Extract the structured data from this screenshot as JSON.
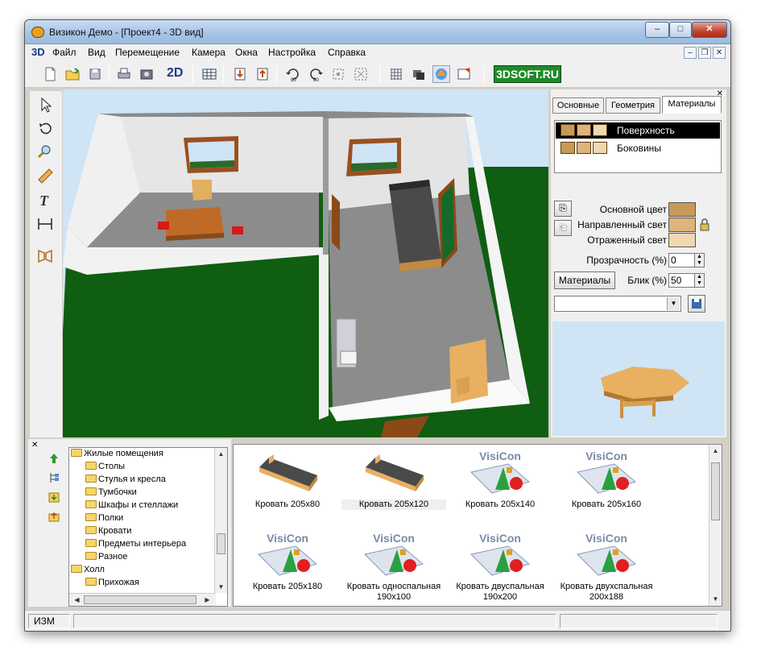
{
  "window": {
    "title": "Визикон Демо - [Проект4 - 3D вид]",
    "controls": {
      "minimize": "‒",
      "maximize": "□",
      "close": "✕"
    }
  },
  "menubar": {
    "logo": "3D",
    "items": [
      "Файл",
      "Вид",
      "Перемещение",
      "Камера",
      "Окна",
      "Настройка",
      "Справка"
    ],
    "mdi": {
      "minimize": "–",
      "restore": "❐",
      "close": "✕"
    }
  },
  "toolbar": {
    "label_2d": "2D",
    "brand": "3DSOFT.RU",
    "icons": [
      "new-file-icon",
      "open-folder-icon",
      "save-icon",
      "print-icon",
      "print-preview-icon",
      "2d-view",
      "table-icon",
      "import-icon",
      "export-icon",
      "rotate-left-90-icon",
      "rotate-right-90-icon",
      "select-group-icon",
      "ungroup-icon",
      "grid-icon",
      "layers-icon",
      "materials-icon",
      "properties-icon"
    ]
  },
  "left_tools": [
    "pointer-icon",
    "rotate-icon",
    "zoom-icon",
    "ruler-icon",
    "text-icon",
    "dimension-icon",
    "door-icon"
  ],
  "right_panel": {
    "tabs": [
      "Основные",
      "Геометрия",
      "Материалы"
    ],
    "active_tab": "Материалы",
    "materials": [
      {
        "label": "Поверхность",
        "selected": true
      },
      {
        "label": "Боковины",
        "selected": false
      }
    ],
    "properties": {
      "main_color_label": "Основной цвет",
      "directed_light_label": "Направленный свет",
      "reflected_light_label": "Отраженный свет",
      "transparency_label": "Прозрачность (%)",
      "transparency_value": "0",
      "gloss_label": "Блик (%)",
      "gloss_value": "50",
      "materials_button": "Материалы",
      "combo_value": ""
    },
    "colors": {
      "main": "#c89a58",
      "directed": "#dcb47c",
      "reflected": "#f0d8b0"
    }
  },
  "tree": {
    "items": [
      {
        "label": "Жилые помещения",
        "level": 0
      },
      {
        "label": "Столы",
        "level": 1
      },
      {
        "label": "Стулья и кресла",
        "level": 1
      },
      {
        "label": "Тумбочки",
        "level": 1
      },
      {
        "label": "Шкафы и стеллажи",
        "level": 1
      },
      {
        "label": "Полки",
        "level": 1
      },
      {
        "label": "Кровати",
        "level": 1
      },
      {
        "label": "Предметы интерьера",
        "level": 1
      },
      {
        "label": "Разное",
        "level": 1
      },
      {
        "label": "Холл",
        "level": 0
      },
      {
        "label": "Прихожая",
        "level": 1
      }
    ],
    "side_icons": [
      "arrow-up-icon",
      "tree-structure-icon",
      "save-library-icon",
      "open-library-icon"
    ]
  },
  "gallery": {
    "placeholder_brand": "VisiCon",
    "items": [
      {
        "caption": "Кровать 205x80",
        "thumb": "bed"
      },
      {
        "caption": "Кровать 205x120",
        "thumb": "bed",
        "selected": true
      },
      {
        "caption": "Кровать 205x140",
        "thumb": "visicon"
      },
      {
        "caption": "Кровать 205x160",
        "thumb": "visicon"
      },
      {
        "caption": "Кровать 205x180",
        "thumb": "visicon"
      },
      {
        "caption": "Кровать односпальная\n190x100",
        "thumb": "visicon"
      },
      {
        "caption": "Кровать двуспальная\n190x200",
        "thumb": "visicon"
      },
      {
        "caption": "Кровать двухспальная\n200x188",
        "thumb": "visicon"
      }
    ]
  },
  "statusbar": {
    "mode": "ИЗМ",
    "message": ""
  }
}
